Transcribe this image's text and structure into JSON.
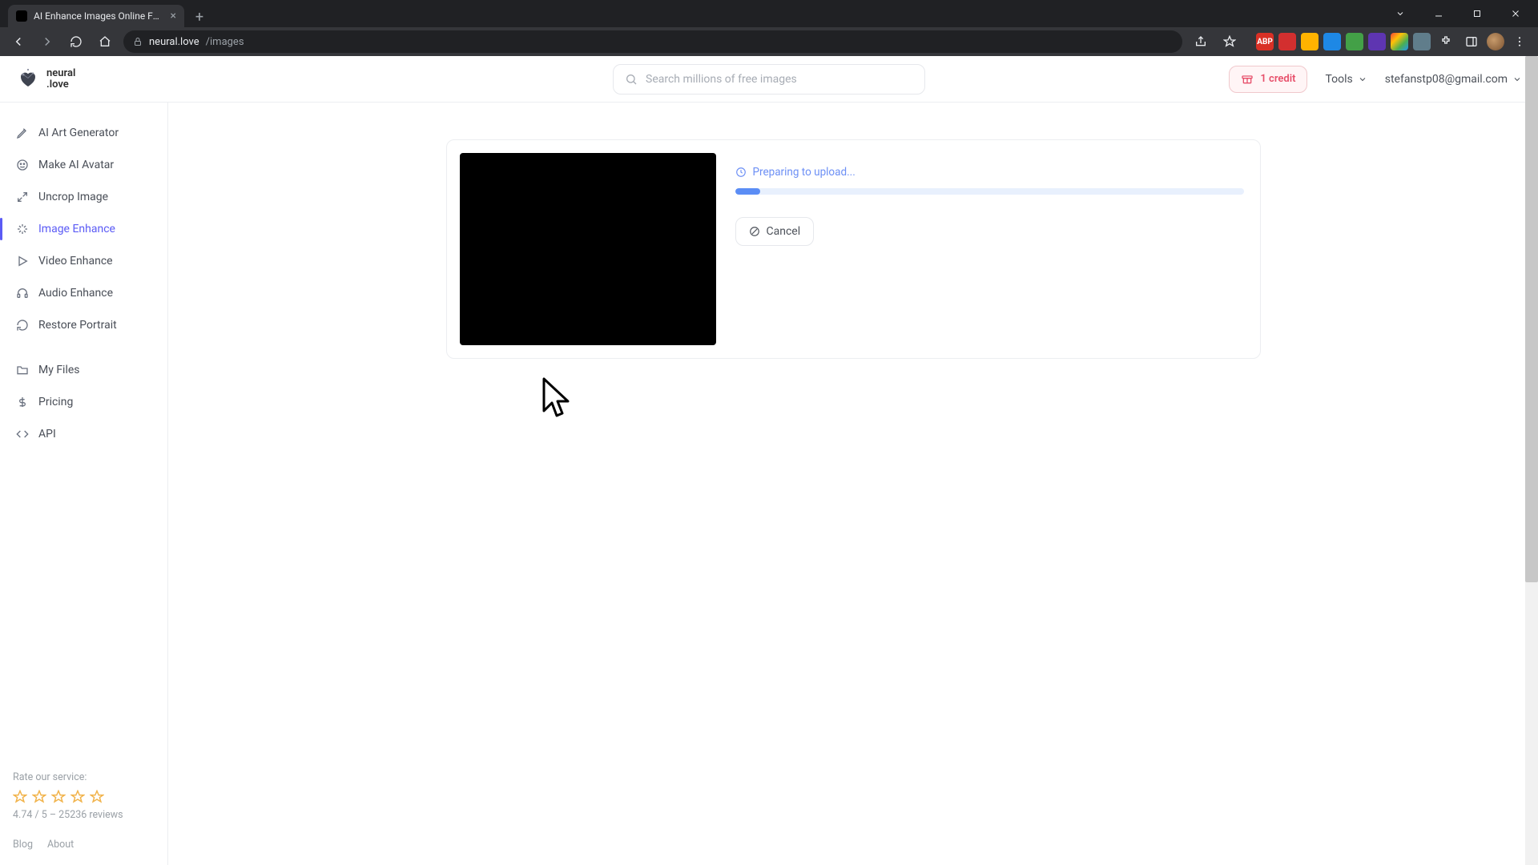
{
  "browser": {
    "tab_title": "AI Enhance Images Online For Fr",
    "url_domain": "neural.love",
    "url_path": "/images"
  },
  "header": {
    "logo_line1": "neural",
    "logo_line2": ".love",
    "search_placeholder": "Search millions of free images",
    "credit_label": "1 credit",
    "tools_label": "Tools",
    "user_email": "stefanstp08@gmail.com"
  },
  "sidebar": {
    "items": [
      {
        "label": "AI Art Generator",
        "icon": "pen-icon",
        "active": false
      },
      {
        "label": "Make AI Avatar",
        "icon": "face-icon",
        "active": false
      },
      {
        "label": "Uncrop Image",
        "icon": "expand-icon",
        "active": false
      },
      {
        "label": "Image Enhance",
        "icon": "sparkle-icon",
        "active": true
      },
      {
        "label": "Video Enhance",
        "icon": "play-icon",
        "active": false
      },
      {
        "label": "Audio Enhance",
        "icon": "headphones-icon",
        "active": false
      },
      {
        "label": "Restore Portrait",
        "icon": "restore-icon",
        "active": false
      }
    ],
    "secondary": [
      {
        "label": "My Files",
        "icon": "folder-icon"
      },
      {
        "label": "Pricing",
        "icon": "dollar-icon"
      },
      {
        "label": "API",
        "icon": "code-icon"
      }
    ],
    "rate_label": "Rate our service:",
    "rating_line": "4.74 / 5 – 25236 reviews",
    "footer_links": [
      "Blog",
      "About"
    ]
  },
  "upload": {
    "status_text": "Preparing to upload...",
    "cancel_label": "Cancel",
    "progress_percent": 5
  }
}
